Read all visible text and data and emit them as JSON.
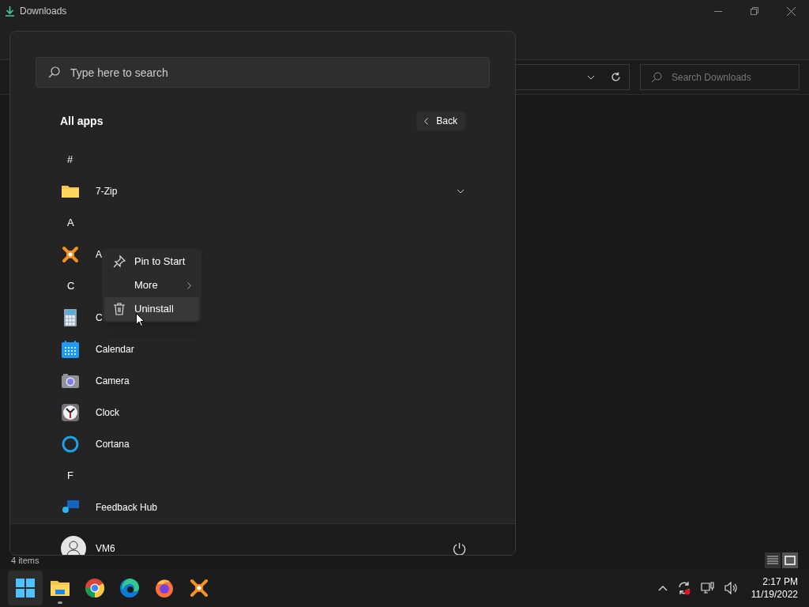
{
  "explorer": {
    "title": "Downloads",
    "search": {
      "placeholder": "Search Downloads"
    },
    "status": "4 items"
  },
  "start_menu": {
    "search": {
      "placeholder": "Type here to search"
    },
    "heading": "All apps",
    "back_button": "Back",
    "apps": [
      {
        "kind": "letter",
        "label": "#"
      },
      {
        "kind": "folder",
        "label": "7-Zip",
        "expanded": false
      },
      {
        "kind": "letter",
        "label": "A"
      },
      {
        "kind": "avast",
        "label": "A"
      },
      {
        "kind": "letter",
        "label": "C"
      },
      {
        "kind": "calculator",
        "label": "C"
      },
      {
        "kind": "calendar",
        "label": "Calendar"
      },
      {
        "kind": "camera",
        "label": "Camera"
      },
      {
        "kind": "clock",
        "label": "Clock"
      },
      {
        "kind": "ring",
        "label": "Cortana"
      },
      {
        "kind": "letter",
        "label": "F"
      },
      {
        "kind": "bubble",
        "label": "Feedback Hub"
      }
    ],
    "user": "VM6",
    "context_menu": [
      {
        "label": "Pin to Start",
        "kind": "pin",
        "submenu": false,
        "selected": false
      },
      {
        "label": "More",
        "kind": "plain",
        "submenu": true,
        "selected": false
      },
      {
        "label": "Uninstall",
        "kind": "trash",
        "submenu": false,
        "selected": true
      }
    ]
  },
  "taskbar": {
    "apps": [
      {
        "kind": "start",
        "selected": true,
        "running": false
      },
      {
        "kind": "explorer",
        "selected": false,
        "running": true
      },
      {
        "kind": "chrome",
        "selected": false,
        "running": false
      },
      {
        "kind": "edge",
        "selected": false,
        "running": false
      },
      {
        "kind": "firefox",
        "selected": false,
        "running": false
      },
      {
        "kind": "avast",
        "selected": false,
        "running": false
      }
    ],
    "time": "2:17 PM",
    "date": "11/19/2022"
  }
}
